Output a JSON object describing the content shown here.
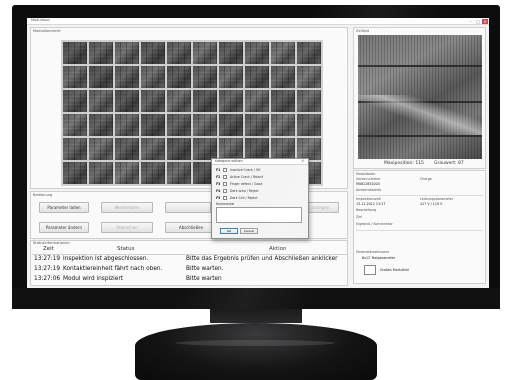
{
  "window": {
    "title": "Modulhaus"
  },
  "module_view": {
    "title": "Modulübersicht",
    "rows": 6,
    "cols": 10
  },
  "cell_view": {
    "title": "Zellbild",
    "position_label": "Maxiposition: 115",
    "gray_label": "Grauwert: 87"
  },
  "module_details": {
    "header": "Moduldaten",
    "fields": [
      {
        "label": "Seriennummer",
        "value": "M0612852003"
      },
      {
        "label": "Charge",
        "value": ""
      },
      {
        "label": "Ambientewerte",
        "value": ""
      },
      {
        "label": "Inspektionszeit",
        "value": "13.11.2012 13:27"
      },
      {
        "label": "Leistungsparameter",
        "value": "417 V / 119 V"
      },
      {
        "label": "Bearbeitung",
        "value": ""
      },
      {
        "label": "Ziel",
        "value": ""
      },
      {
        "label": "Ergebnis / Kommentar",
        "value": ""
      }
    ],
    "param_header": "Parametersetsname",
    "param_value": "6x12 Testparameter",
    "large_module_label": "Großes Modulbild"
  },
  "controls": {
    "title": "Bedienung",
    "buttons": {
      "load_params": "Parameter laden",
      "repeat": "Wiederholen",
      "show_report": "Report anzeigen",
      "change_params": "Parameter ändern",
      "abort": "Abbrechen",
      "finish": "Abschließen"
    },
    "preview_label": "Vorschau"
  },
  "status": {
    "title": "Statusinformationen",
    "columns": {
      "time": "Zeit",
      "status": "Status",
      "action": "Aktion"
    },
    "rows": [
      {
        "time": "13:27:19",
        "status": "Inspektion ist abgeschlossen.",
        "action": "Bitte das Ergebnis prüfen und Abschließen anklicker"
      },
      {
        "time": "13:27:19",
        "status": "Kontaktiereinheit fährt nach oben.",
        "action": "Bitte warten."
      },
      {
        "time": "13:27:06",
        "status": "Modul wird inspiziert",
        "action": "Bitte warten"
      }
    ]
  },
  "dialog": {
    "title": "Kategorie wählen",
    "options": [
      {
        "code": "F1",
        "label": "Inactive Crack / OK",
        "checked": false
      },
      {
        "code": "F2",
        "label": "Active Crack / Reject",
        "checked": false
      },
      {
        "code": "F3",
        "label": "Finger defect / Good",
        "checked": false
      },
      {
        "code": "F4",
        "label": "Dark area / Reject",
        "checked": false
      },
      {
        "code": "F5",
        "label": "Dark Cell / Reject",
        "checked": false
      }
    ],
    "comment_label": "Kommentar",
    "ok_label": "OK",
    "cancel_label": "Cancel"
  }
}
